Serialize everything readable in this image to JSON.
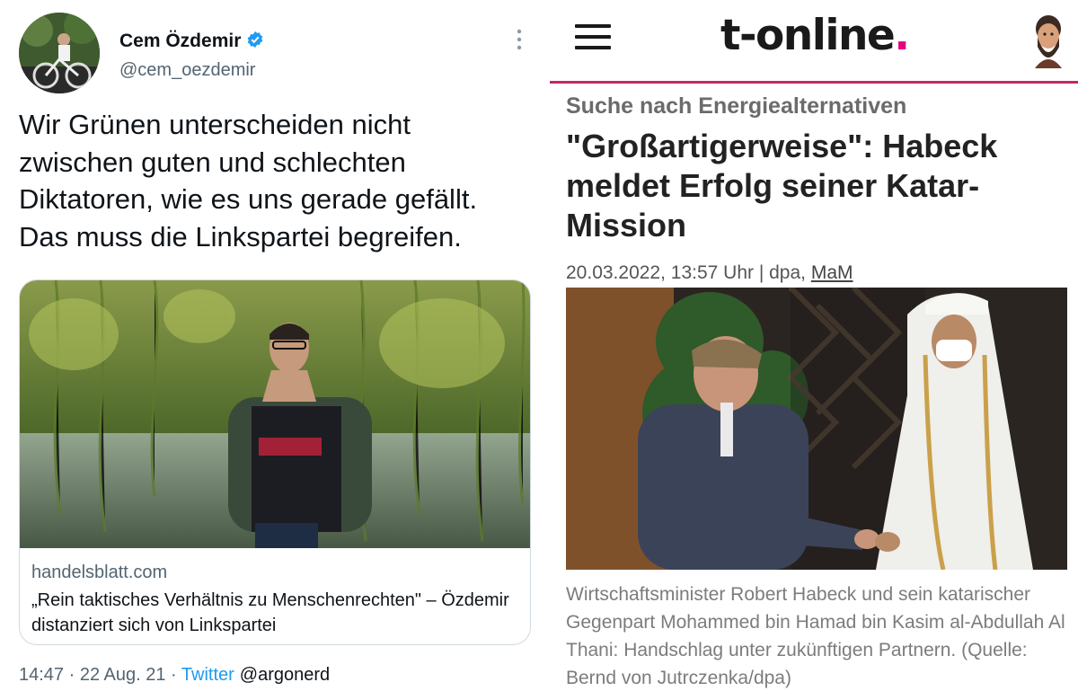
{
  "tweet": {
    "author_name": "Cem Özdemir",
    "handle": "@cem_oezdemir",
    "text": "Wir Grünen unterscheiden nicht zwischen guten und schlechten Diktatoren, wie es uns gerade gefällt. Das muss die Linkspartei begreifen.",
    "card": {
      "domain": "handelsblatt.com",
      "title": "„Rein taktisches Verhältnis zu Menschenrechten\" – Özdemir distanziert sich von Linkspartei"
    },
    "meta": {
      "time_date": "14:47 · 22 Aug. 21 · ",
      "source": "Twitter",
      "credit": "@argonerd"
    }
  },
  "article": {
    "logo_text": "t-online",
    "logo_dot": ".",
    "kicker": "Suche nach Energiealternativen",
    "headline": "\"Großartigerweise\": Habeck meldet Erfolg seiner Katar-Mission",
    "byline_prefix": "20.03.2022, 13:57 Uhr | dpa, ",
    "byline_author": "MaM",
    "caption": "Wirtschaftsminister Robert Habeck und sein katarischer Gegenpart Mohammed bin Hamad bin Kasim al-Abdullah Al Thani: Handschlag unter zukünftigen Partnern. (Quelle: Bernd von Jutrczenka/dpa)"
  },
  "colors": {
    "twitter_blue": "#1d9bf0",
    "text_primary": "#0f1419",
    "text_secondary": "#536471",
    "t_online_magenta": "#e6007e",
    "nav_line": "#c4266b"
  },
  "icons": [
    "verified-badge-icon",
    "more-options-icon",
    "hamburger-menu-icon",
    "user-profile-icon"
  ]
}
